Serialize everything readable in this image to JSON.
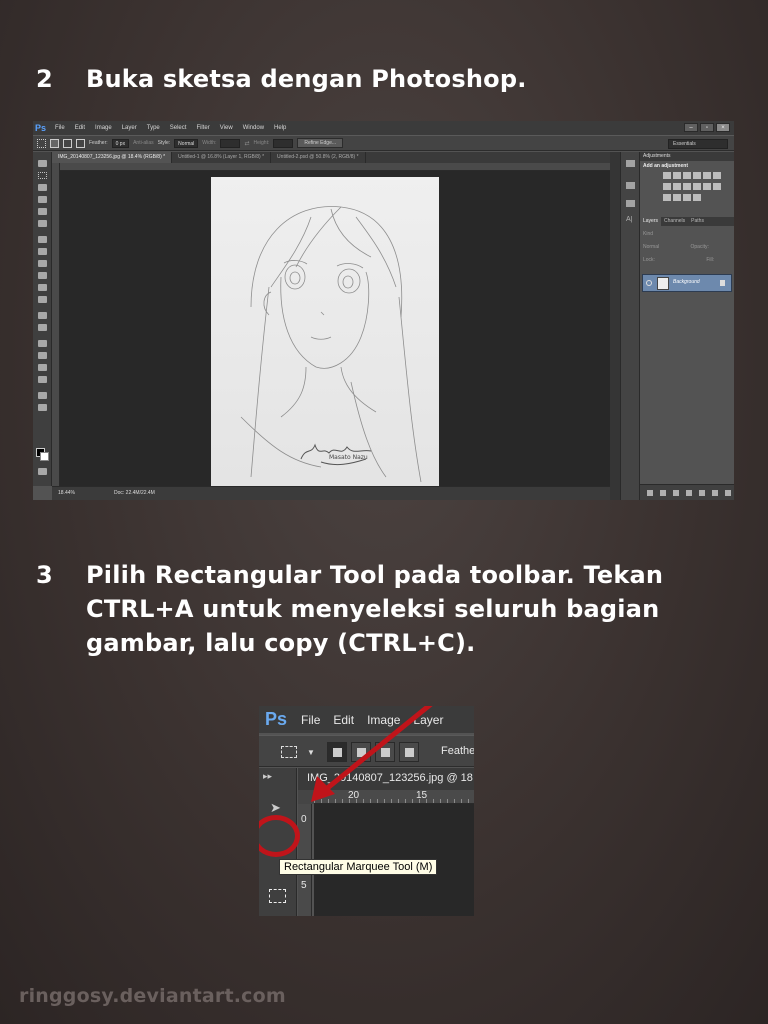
{
  "step2": {
    "number": "2",
    "text": "Buka sketsa dengan Photoshop."
  },
  "step3": {
    "number": "3",
    "text": "Pilih Rectangular Tool pada toolbar. Tekan CTRL+A untuk menyeleksi seluruh bagian gambar, lalu copy (CTRL+C)."
  },
  "screenshot1": {
    "logo": "Ps",
    "menu": [
      "File",
      "Edit",
      "Image",
      "Layer",
      "Type",
      "Select",
      "Filter",
      "View",
      "Window",
      "Help"
    ],
    "options": {
      "feather_label": "Feather:",
      "feather_value": "0 px",
      "antialias": "Anti-alias",
      "style_label": "Style:",
      "style_value": "Normal",
      "width_label": "Width:",
      "height_label": "Height:",
      "refine": "Refine Edge...",
      "workspace": "Essentials"
    },
    "tabs": [
      "IMG_20140807_123256.jpg @ 18.4% (RGB/8) *",
      "Untitled-1 @ 16.8% (Layer 1, RGB/8) *",
      "Untitled-2.psd @ 50.8% (2, RGB/8) *"
    ],
    "status": {
      "zoom": "18.44%",
      "doc": "Doc: 22.4M/22.4M"
    },
    "panels": {
      "adjustments_title": "Adjustments",
      "adjustments_sub": "Add an adjustment",
      "layer_tabs": [
        "Layers",
        "Channels",
        "Paths"
      ],
      "kind": "Kind",
      "blend": "Normal",
      "opacity": "Opacity:",
      "lock": "Lock:",
      "fill": "Fill:",
      "layer_name": "Background"
    },
    "signature": "Masato Nazu"
  },
  "screenshot2": {
    "logo": "Ps",
    "menu": [
      "File",
      "Edit",
      "Image",
      "Layer"
    ],
    "feather": "Feather",
    "tab": "IMG_20140807_123256.jpg @ 18",
    "ruler": [
      "20",
      "15"
    ],
    "ruler_v": [
      "0",
      "5"
    ],
    "tooltip": "Rectangular Marquee Tool (M)",
    "highlight_color": "#c0141a"
  },
  "footer": "ringgosy.deviantart.com"
}
